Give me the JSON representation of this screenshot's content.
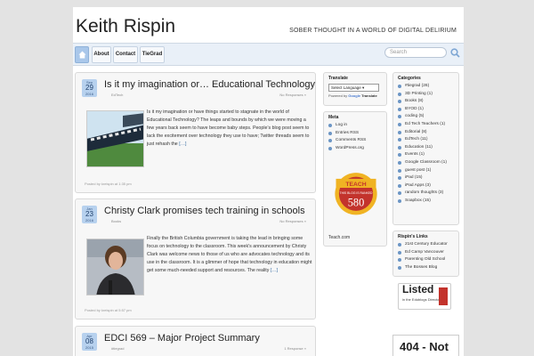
{
  "site": {
    "title": "Keith Rispin",
    "tagline": "SOBER THOUGHT IN A WORLD OF DIGITAL DELIRIUM"
  },
  "nav": {
    "items": [
      "About",
      "Contact",
      "TieGrad"
    ],
    "search_placeholder": "Search"
  },
  "posts": [
    {
      "month": "Sep",
      "day": "29",
      "year": "2016",
      "title": "Is it my imagination or… Educational Technology",
      "category": "EdTech",
      "responses": "No Responses »",
      "excerpt": "Is it my imagination or have things started to stagnate in the world of Educational Technology? The leaps and bounds by which we were moving a few years back seem to have become baby steps. People's blog post seem to lack the excitement over technology they use to have; Twitter threads seem to just rehash the",
      "more": "[…]",
      "footer": "Posted by kreispin at 1:35 pm"
    },
    {
      "month": "Jan",
      "day": "23",
      "year": "2016",
      "title": "Christy Clark promises tech training in schools",
      "category": "Books",
      "responses": "No Responses »",
      "excerpt": "Finally the British Columbia government is taking the lead in bringing some focus on technology to the classroom. This week's announcement by Christy Clark was welcome news to those of us who are advocates technology and its use in the classroom. It is a glimmer of hope that technology in education might get some much-needed support and resources. The reality",
      "more": "[…]",
      "footer": "Posted by kreispin at 5:57 pm"
    },
    {
      "month": "Apr",
      "day": "08",
      "year": "2015",
      "title": "EDCI 569 – Major Project Summary",
      "category": "#tiegrad",
      "responses": "1 Response »"
    }
  ],
  "sidebar_left": {
    "translate_title": "Translate",
    "select_language": "Select Language",
    "powered_by": "Powered by",
    "google": "Google",
    "translate_word": "Translate",
    "meta_title": "Meta",
    "meta_items": [
      "Log in",
      "Entries RSS",
      "Comments RSS",
      "WordPress.org"
    ],
    "badge": {
      "teach": "TEACH",
      "num100": "100",
      "ranked": "THIS BLOG IS RANKED",
      "rank": "580"
    },
    "teach_com": "Teach.com"
  },
  "sidebar_right": {
    "categories_title": "Categories",
    "categories": [
      "#tiegrad (26)",
      "3D Printing (1)",
      "Books (8)",
      "BYOD (1)",
      "coding (5)",
      "Ed Tech Teachers (1)",
      "Editorial (8)",
      "EdTech (11)",
      "Education (11)",
      "Events (1)",
      "Google Classroom (1)",
      "guest post (1)",
      "iPad (15)",
      "iPad Apps (3)",
      "random thoughts (3)",
      "Soapbox (15)"
    ],
    "links_title": "Rispin's Links",
    "links": [
      "21st Century Educator",
      "Ed Camp Vancouver",
      "Parenting Old School",
      "The Bosses Blog"
    ],
    "listed": "Listed",
    "listed_sub": "in the Edublogs Directory",
    "notfound": "404 - Not Found"
  },
  "colors": {
    "accent": "#b7d1ee",
    "link": "#3a6ea5",
    "badge_red": "#c3332c",
    "badge_gold": "#f0b323"
  }
}
